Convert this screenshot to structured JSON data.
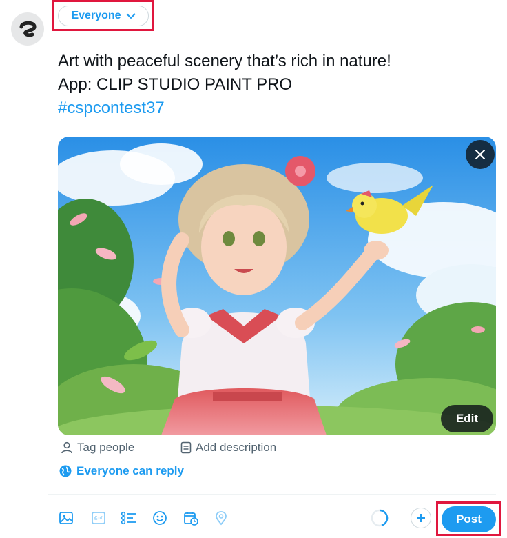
{
  "composer": {
    "audience_label": "Everyone",
    "text_lines": [
      "Art with peaceful scenery that’s rich in nature!",
      "App: CLIP STUDIO PAINT PRO"
    ],
    "hashtag": "#cspcontest37",
    "media": {
      "edit_label": "Edit"
    },
    "tag_people_label": "Tag people",
    "add_description_label": "Add description",
    "reply_setting_label": "Everyone can reply",
    "post_label": "Post"
  },
  "colors": {
    "accent": "#1d9bf0",
    "highlight": "#e0173e"
  },
  "toolbar": {
    "icons": [
      "image-icon",
      "gif-icon",
      "poll-icon",
      "emoji-icon",
      "schedule-icon",
      "location-icon"
    ]
  }
}
